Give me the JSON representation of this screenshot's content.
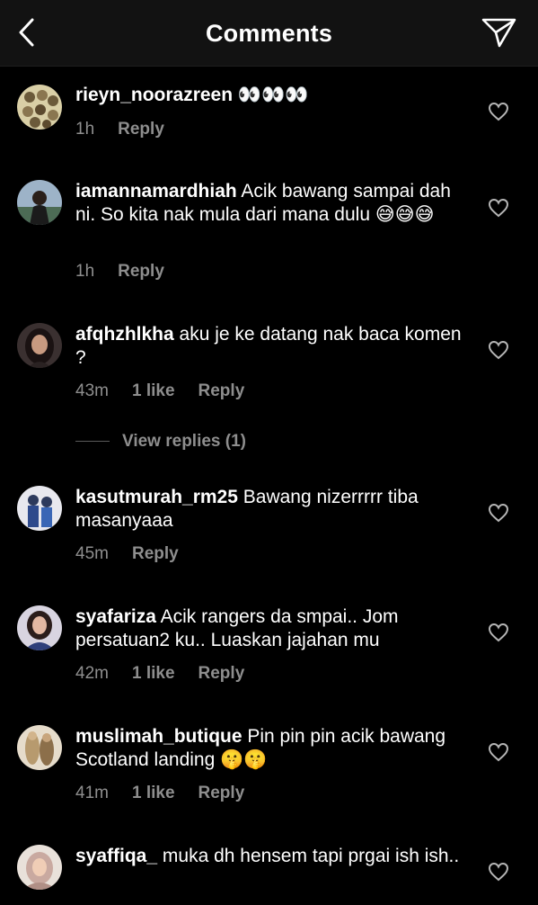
{
  "header": {
    "title": "Comments",
    "back_icon": "chevron-left-icon",
    "share_icon": "send-icon"
  },
  "comments": [
    {
      "username": "rieyn_noorazreen",
      "text": "",
      "emoji": "👀👀👀",
      "time": "1h",
      "likes": "",
      "reply": "Reply"
    },
    {
      "username": "iamannamardhiah",
      "text": "Acik bawang sampai dah ni. So kita nak mula dari mana dulu",
      "emoji": "😅😅😅",
      "time": "1h",
      "likes": "",
      "reply": "Reply"
    },
    {
      "username": "afqhzhlkha",
      "text": "aku je ke datang nak baca komen ?",
      "emoji": "",
      "time": "43m",
      "likes": "1 like",
      "reply": "Reply"
    },
    {
      "username": "kasutmurah_rm25",
      "text": "Bawang nizerrrrr tiba masanyaaa",
      "emoji": "",
      "time": "45m",
      "likes": "",
      "reply": "Reply"
    },
    {
      "username": "syafariza",
      "text": "Acik rangers da smpai.. Jom persatuan2 ku.. Luaskan jajahan mu",
      "emoji": "",
      "time": "42m",
      "likes": "1 like",
      "reply": "Reply"
    },
    {
      "username": "muslimah_butique",
      "text": "Pin pin pin acik bawang Scotland landing",
      "emoji": "🤫🤫",
      "time": "41m",
      "likes": "1 like",
      "reply": "Reply"
    },
    {
      "username": "syaffiqa_",
      "text": "muka dh hensem tapi prgai ish ish..",
      "emoji": "",
      "time": "",
      "likes": "",
      "reply": ""
    }
  ],
  "view_replies": "View replies (1)",
  "colors": {
    "background": "#000000",
    "header": "#121212",
    "secondary_text": "#8e8e8e"
  }
}
